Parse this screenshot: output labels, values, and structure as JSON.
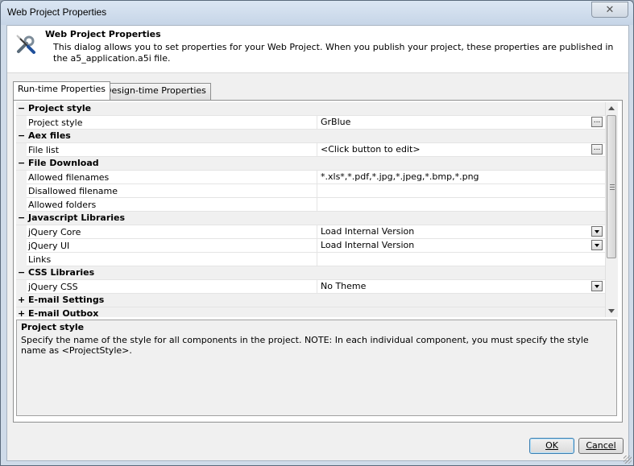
{
  "window": {
    "title": "Web Project Properties",
    "close_glyph": "✕"
  },
  "header": {
    "icon": "tools-icon",
    "title": "Web Project Properties",
    "description": "This dialog allows you to set properties for your Web Project. When you publish your project, these properties are published in the a5_application.a5i file."
  },
  "tabs": [
    {
      "label": "Run-time Properties",
      "active": true
    },
    {
      "label": "Design-time Properties",
      "active": false
    }
  ],
  "grid": {
    "rows": [
      {
        "type": "category",
        "expander": "−",
        "label": "Project style"
      },
      {
        "type": "property",
        "name": "Project style",
        "value": "GrBlue",
        "editor": "ellipsis"
      },
      {
        "type": "category",
        "expander": "−",
        "label": "Aex files"
      },
      {
        "type": "property",
        "name": "File list",
        "value": "<Click button to edit>",
        "editor": "ellipsis"
      },
      {
        "type": "category",
        "expander": "−",
        "label": "File Download"
      },
      {
        "type": "property",
        "name": "Allowed filenames",
        "value": "*.xls*,*.pdf,*.jpg,*.jpeg,*.bmp,*.png",
        "editor": "none"
      },
      {
        "type": "property",
        "name": "Disallowed filename",
        "value": "",
        "editor": "none"
      },
      {
        "type": "property",
        "name": "Allowed folders",
        "value": "",
        "editor": "none"
      },
      {
        "type": "category",
        "expander": "−",
        "label": "Javascript Libraries"
      },
      {
        "type": "property",
        "name": "jQuery Core",
        "value": "Load Internal Version",
        "editor": "dropdown"
      },
      {
        "type": "property",
        "name": "jQuery UI",
        "value": "Load Internal Version",
        "editor": "dropdown"
      },
      {
        "type": "property",
        "name": "Links",
        "value": "",
        "editor": "none"
      },
      {
        "type": "category",
        "expander": "−",
        "label": "CSS Libraries"
      },
      {
        "type": "property",
        "name": "jQuery CSS",
        "value": "No Theme",
        "editor": "dropdown"
      },
      {
        "type": "category",
        "expander": "+",
        "label": "E-mail Settings"
      },
      {
        "type": "category",
        "expander": "+",
        "label": "E-mail Outbox"
      }
    ],
    "ellipsis_label": "..."
  },
  "help": {
    "title": "Project style",
    "description": "Specify the name of the style for all components in the project. NOTE: In each individual component, you must specify the style name as <ProjectStyle>."
  },
  "footer": {
    "ok_label": "OK",
    "cancel_label": "Cancel"
  }
}
